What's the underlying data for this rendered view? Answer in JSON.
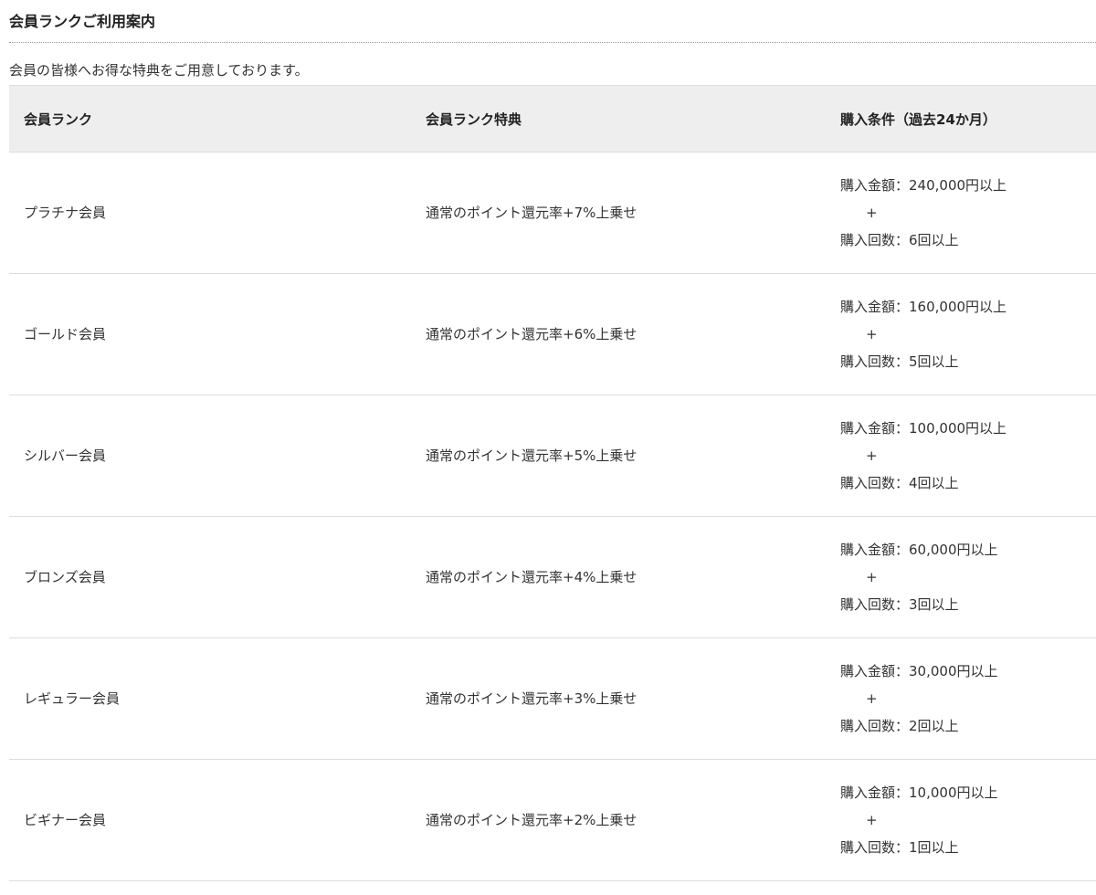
{
  "page": {
    "title": "会員ランクご利用案内",
    "intro": "会員の皆様へお得な特典をご用意しております。"
  },
  "table": {
    "headers": [
      "会員ランク",
      "会員ランク特典",
      "購入条件（過去24か月）"
    ],
    "rows": [
      {
        "rank": "プラチナ会員",
        "benefit": "通常のポイント還元率+7%上乗せ",
        "amount": "購入金額：240,000円以上",
        "plus": "+",
        "count": "購入回数：6回以上"
      },
      {
        "rank": "ゴールド会員",
        "benefit": "通常のポイント還元率+6%上乗せ",
        "amount": "購入金額：160,000円以上",
        "plus": "+",
        "count": "購入回数：5回以上"
      },
      {
        "rank": "シルバー会員",
        "benefit": "通常のポイント還元率+5%上乗せ",
        "amount": "購入金額：100,000円以上",
        "plus": "+",
        "count": "購入回数：4回以上"
      },
      {
        "rank": "ブロンズ会員",
        "benefit": "通常のポイント還元率+4%上乗せ",
        "amount": "購入金額：60,000円以上",
        "plus": "+",
        "count": "購入回数：3回以上"
      },
      {
        "rank": "レギュラー会員",
        "benefit": "通常のポイント還元率+3%上乗せ",
        "amount": "購入金額：30,000円以上",
        "plus": "+",
        "count": "購入回数：2回以上"
      },
      {
        "rank": "ビギナー会員",
        "benefit": "通常のポイント還元率+2%上乗せ",
        "amount": "購入金額：10,000円以上",
        "plus": "+",
        "count": "購入回数：1回以上"
      }
    ]
  },
  "colors": {
    "header_bg": "#eeeeee",
    "rule": "#dddddd",
    "text": "#333333"
  }
}
